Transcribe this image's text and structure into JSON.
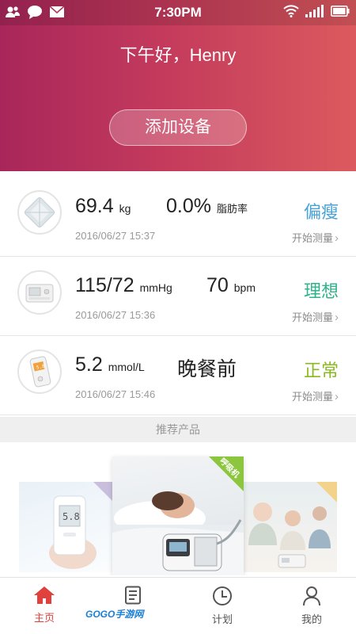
{
  "status_bar": {
    "time": "7:30PM",
    "left_icons": [
      "contacts-icon",
      "chat-bubble-icon",
      "mail-icon"
    ],
    "right_icons": [
      "wifi-icon",
      "signal-icon",
      "battery-icon"
    ]
  },
  "header": {
    "greeting": "下午好，Henry",
    "add_device_label": "添加设备"
  },
  "devices": [
    {
      "icon": "scale-icon",
      "value": "69.4",
      "unit": "kg",
      "secondary_value": "0.0%",
      "secondary_unit": "脂肪率",
      "timestamp": "2016/06/27 15:37",
      "status": "偏瘦",
      "status_color": "#4aa3d8",
      "action": "开始测量"
    },
    {
      "icon": "blood-pressure-monitor-icon",
      "value": "115/72",
      "unit": "mmHg",
      "secondary_value": "70",
      "secondary_unit": "bpm",
      "timestamp": "2016/06/27 15:36",
      "status": "理想",
      "status_color": "#2fb38a",
      "action": "开始测量"
    },
    {
      "icon": "glucose-meter-icon",
      "value": "5.2",
      "unit": "mmol/L",
      "secondary_value": "晚餐前",
      "timestamp": "2016/06/27 15:46",
      "status": "正常",
      "status_color": "#8ab81f",
      "action": "开始测量"
    }
  ],
  "recommend": {
    "title": "推荐产品",
    "products": [
      {
        "name": "glucose-meter-product",
        "reading": "5.8"
      },
      {
        "name": "ventilator-product",
        "badge": "呼吸机"
      },
      {
        "name": "family-blood-pressure-product"
      }
    ]
  },
  "tabs": [
    {
      "label": "主页",
      "icon": "home-icon",
      "active": true
    },
    {
      "label": "",
      "icon": "document-icon",
      "active": false
    },
    {
      "label": "计划",
      "icon": "clock-icon",
      "active": false
    },
    {
      "label": "我的",
      "icon": "person-icon",
      "active": false
    }
  ],
  "watermark": "GOGO手游网",
  "colors": {
    "accent": "#e0413c",
    "header_start": "#a8265a",
    "header_end": "#dc5a5e"
  }
}
